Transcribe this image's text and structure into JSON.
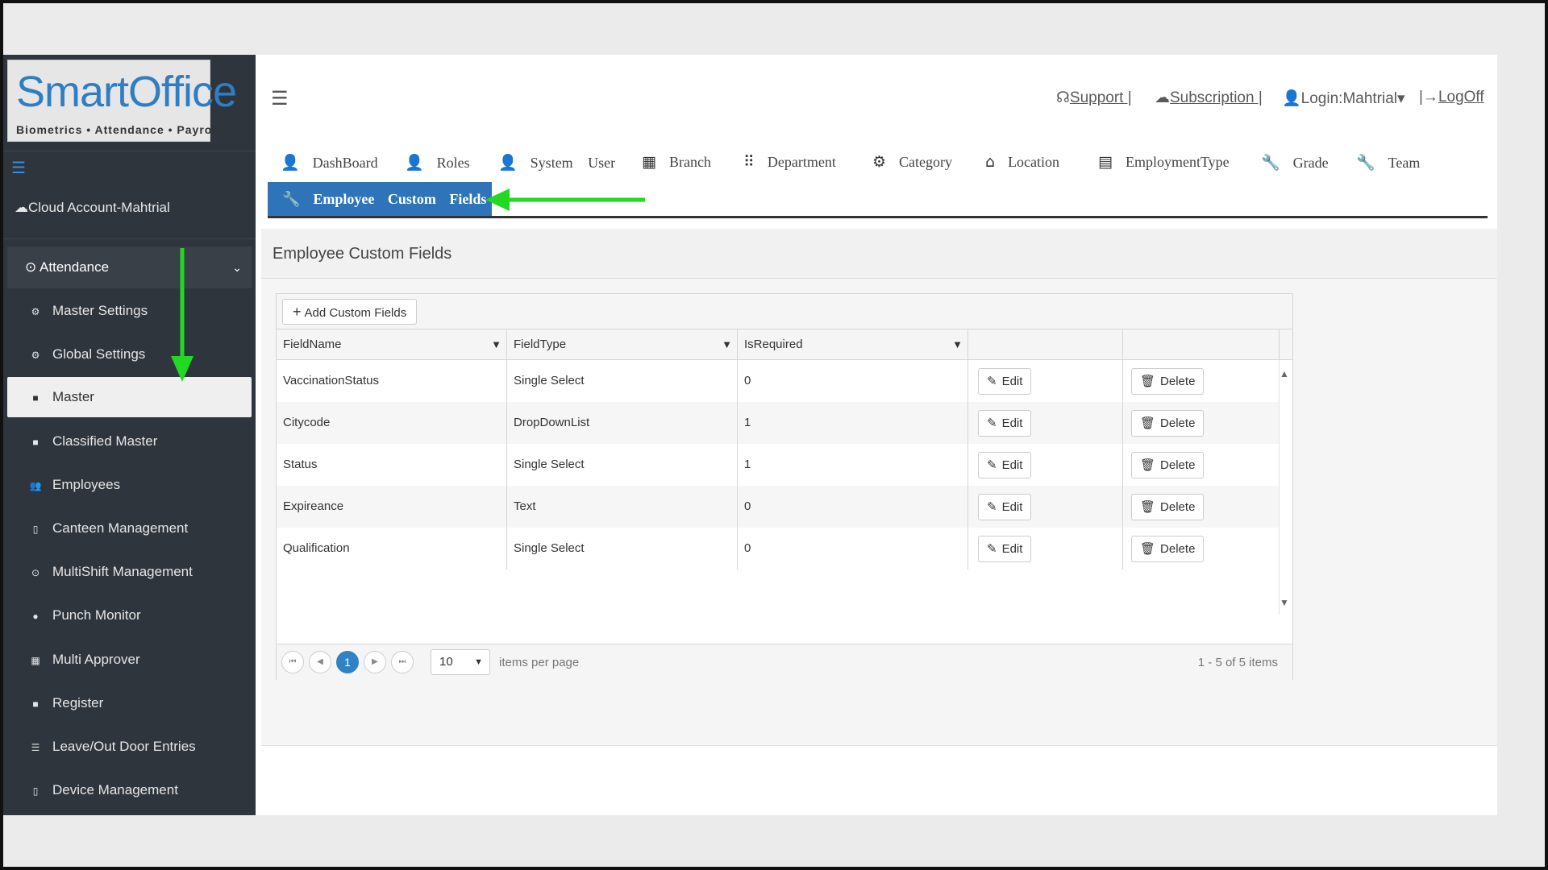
{
  "logo": {
    "title": "SmartOffice",
    "subtitle": "Biometrics • Attendance • Payroll"
  },
  "sidebar": {
    "account": "Cloud Account-Mahtrial",
    "section": "Attendance",
    "items": [
      {
        "label": "Master Settings",
        "icon": "gear-icon"
      },
      {
        "label": "Global Settings",
        "icon": "gear-icon"
      },
      {
        "label": "Master",
        "icon": "square-icon"
      },
      {
        "label": "Classified Master",
        "icon": "square-icon"
      },
      {
        "label": "Employees",
        "icon": "users-icon"
      },
      {
        "label": "Canteen Management",
        "icon": "mobile-icon"
      },
      {
        "label": "MultiShift Management",
        "icon": "clock-icon"
      },
      {
        "label": "Punch Monitor",
        "icon": "circle-icon"
      },
      {
        "label": "Multi Approver",
        "icon": "grid-icon"
      },
      {
        "label": "Register",
        "icon": "square-icon"
      },
      {
        "label": "Leave/Out Door Entries",
        "icon": "list-icon"
      },
      {
        "label": "Device Management",
        "icon": "mobile-icon"
      }
    ]
  },
  "header": {
    "support": "Support |",
    "subscription": "Subscription |",
    "login": "Login:Mahtrial",
    "logoff": "LogOff"
  },
  "nav": {
    "tabs": [
      "DashBoard",
      "Roles",
      "System User",
      "Branch",
      "Department",
      "Category",
      "Location",
      "EmploymentType",
      "Grade",
      "Team"
    ],
    "active": "Employee Custom Fields"
  },
  "page": {
    "title": "Employee Custom Fields"
  },
  "grid": {
    "add_label": "Add Custom Fields",
    "columns": [
      "FieldName",
      "FieldType",
      "IsRequired"
    ],
    "edit_label": "Edit",
    "delete_label": "Delete",
    "rows": [
      {
        "name": "VaccinationStatus",
        "type": "Single Select",
        "required": "0"
      },
      {
        "name": "Citycode",
        "type": "DropDownList",
        "required": "1"
      },
      {
        "name": "Status",
        "type": "Single Select",
        "required": "1"
      },
      {
        "name": "Expireance",
        "type": "Text",
        "required": "0"
      },
      {
        "name": "Qualification",
        "type": "Single Select",
        "required": "0"
      }
    ],
    "pager": {
      "current_page": "1",
      "page_size": "10",
      "per_page_label": "items per page",
      "info": "1 - 5 of 5 items"
    }
  },
  "colors": {
    "accent": "#2f73b8",
    "sidebar": "#2f353c",
    "annotation": "#22d822"
  }
}
